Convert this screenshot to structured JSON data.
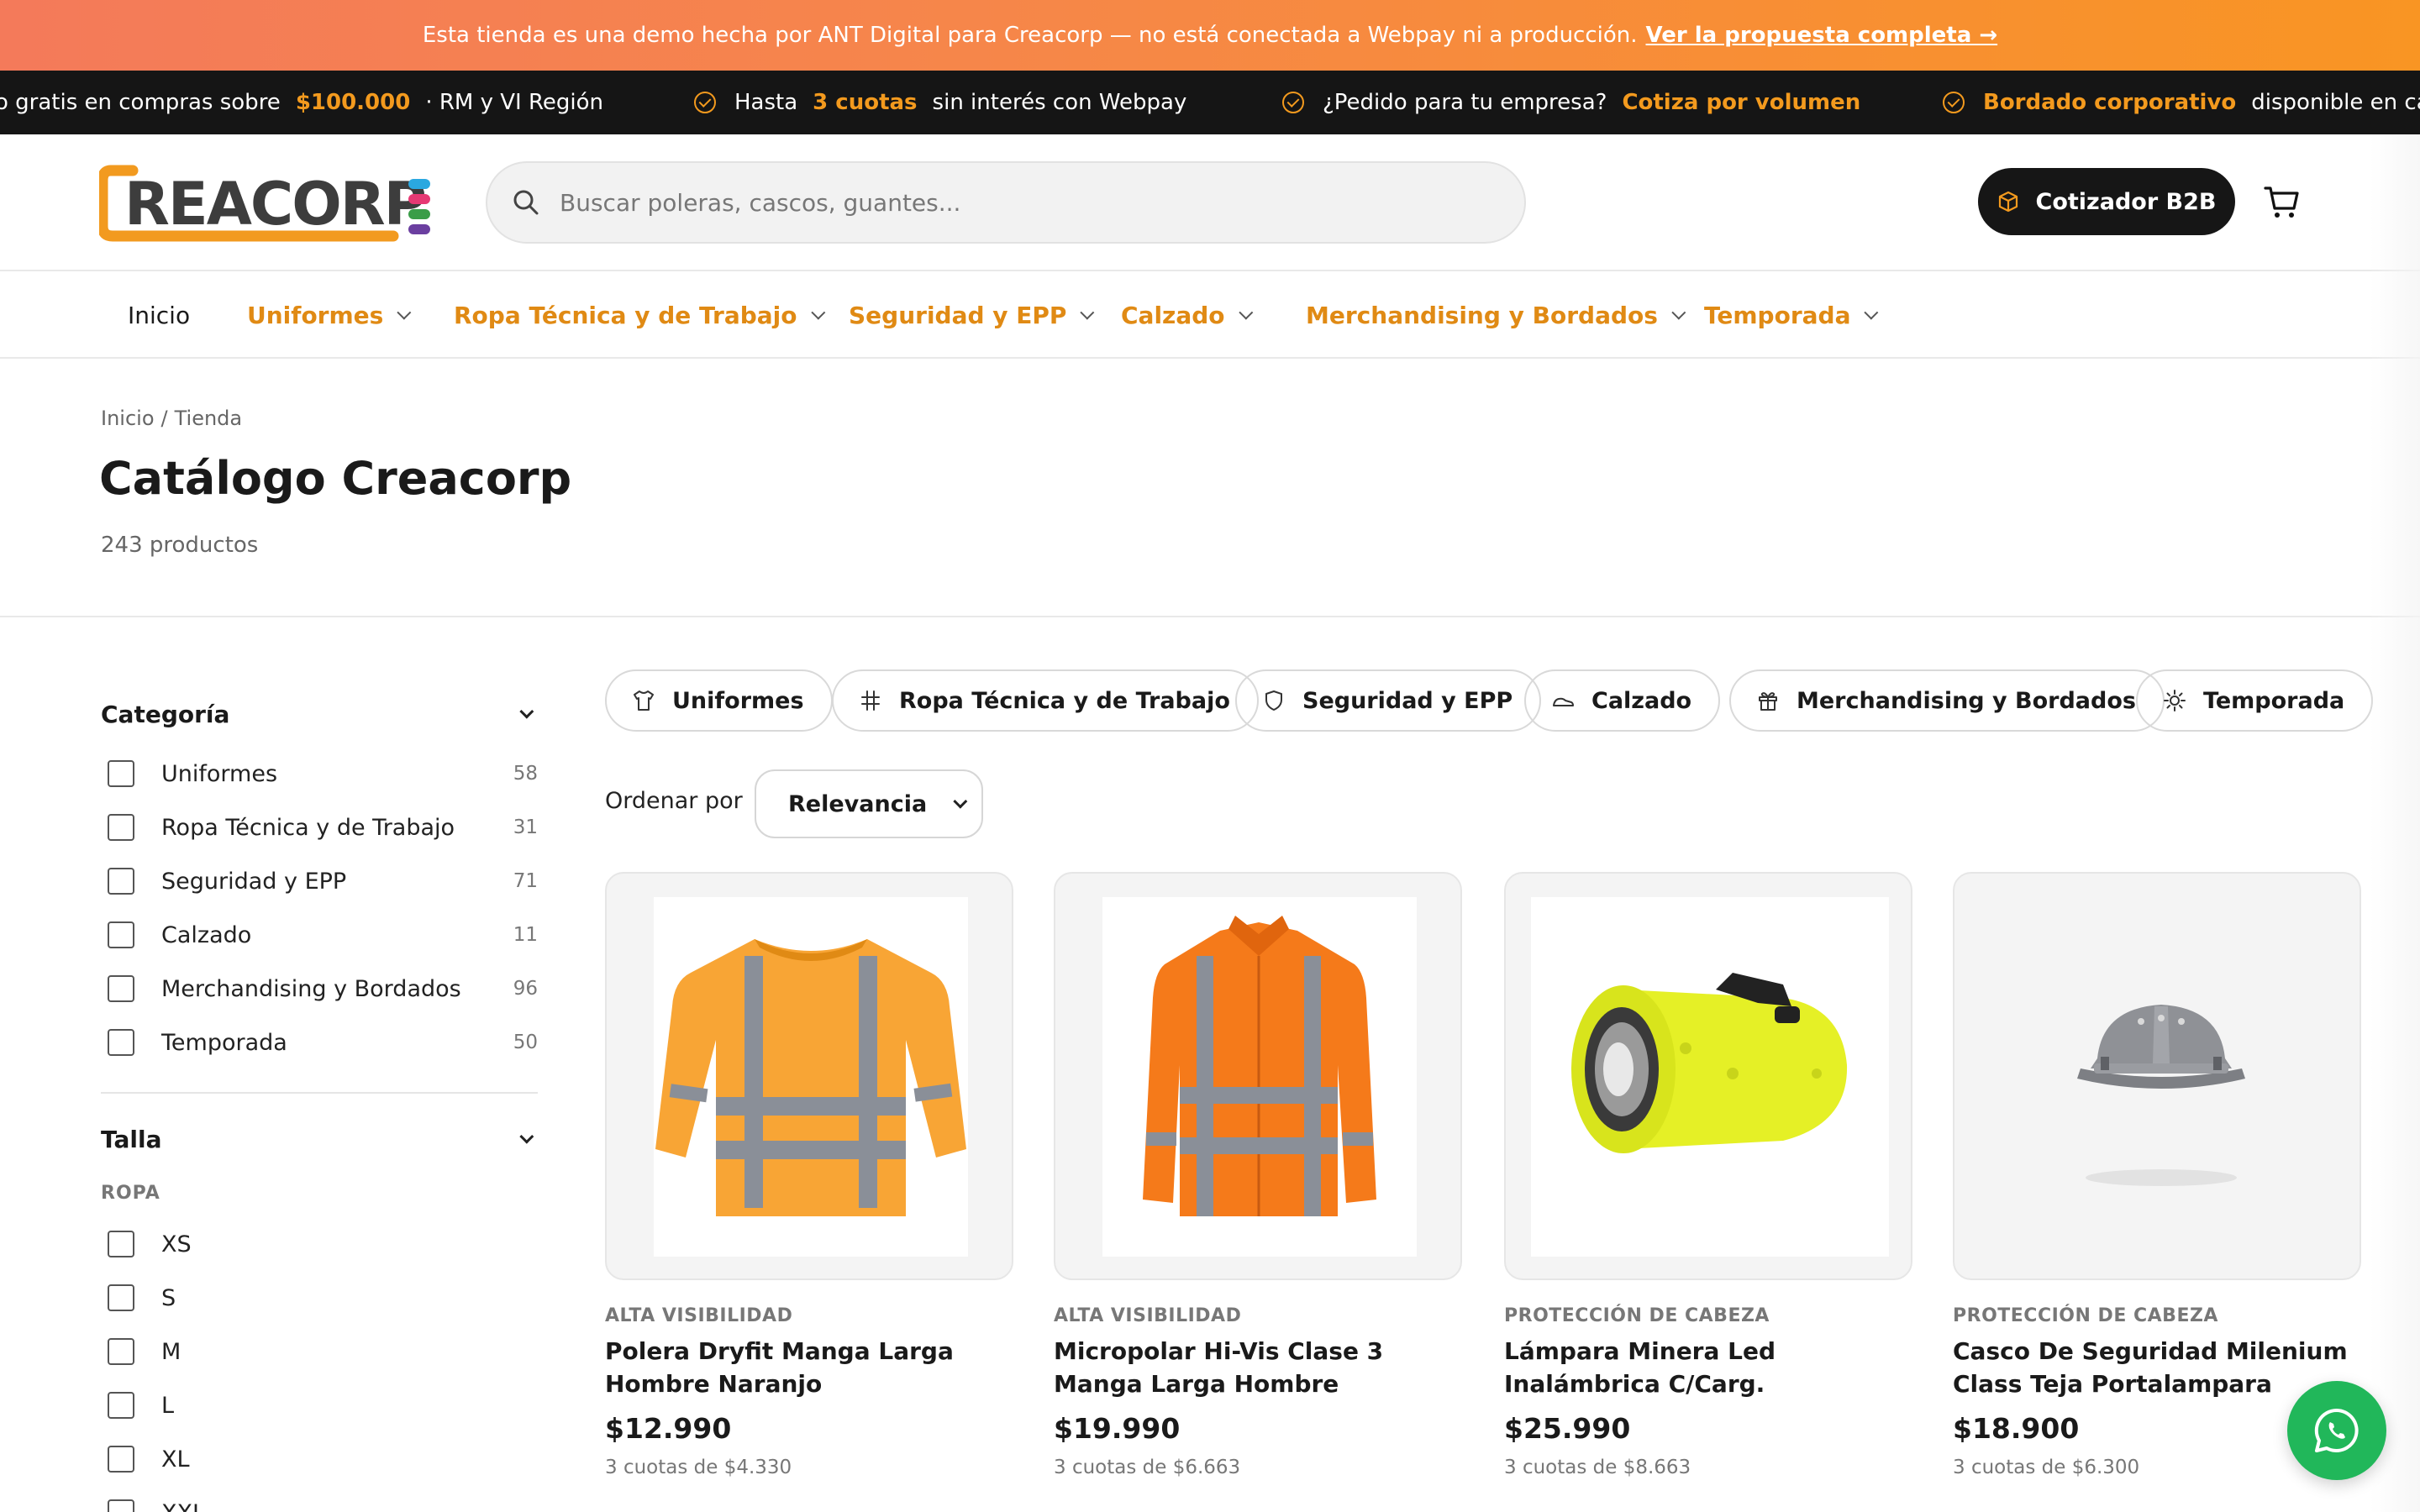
{
  "demo_banner": {
    "text": "Esta tienda es una demo hecha por ANT Digital para Creacorp — no está conectada a Webpay ni a producción.",
    "link": "Ver la propuesta completa →"
  },
  "ticker": [
    {
      "pre": "o gratis en compras sobre",
      "highlight": "$100.000",
      "post": "· RM y VI Región"
    },
    {
      "pre": "Hasta",
      "highlight": "3 cuotas",
      "post": "sin interés con Webpay"
    },
    {
      "pre": "¿Pedido para tu empresa?",
      "highlight": "Cotiza por volumen",
      "post": ""
    },
    {
      "pre": "",
      "highlight": "Bordado corporativo",
      "post": "disponible en ca"
    }
  ],
  "header": {
    "logo_text": "REACORP",
    "search_placeholder": "Buscar poleras, cascos, guantes...",
    "b2b_label": "Cotizador B2B",
    "cart_icon": "cart-icon"
  },
  "nav": {
    "items": [
      {
        "label": "Inicio"
      },
      {
        "label": "Uniformes"
      },
      {
        "label": "Ropa Técnica y de Trabajo"
      },
      {
        "label": "Seguridad y EPP"
      },
      {
        "label": "Calzado"
      },
      {
        "label": "Merchandising y Bordados"
      },
      {
        "label": "Temporada"
      }
    ]
  },
  "breadcrumb": {
    "home": "Inicio",
    "sep": "/",
    "current": "Tienda"
  },
  "page": {
    "title": "Catálogo Creacorp",
    "count": "243 productos"
  },
  "filters": {
    "category_title": "Categoría",
    "categories": [
      {
        "label": "Uniformes",
        "count": "58"
      },
      {
        "label": "Ropa Técnica y de Trabajo",
        "count": "31"
      },
      {
        "label": "Seguridad y EPP",
        "count": "71"
      },
      {
        "label": "Calzado",
        "count": "11"
      },
      {
        "label": "Merchandising y Bordados",
        "count": "96"
      },
      {
        "label": "Temporada",
        "count": "50"
      }
    ],
    "size_title": "Talla",
    "size_group": "ROPA",
    "sizes": [
      "XS",
      "S",
      "M",
      "L",
      "XL",
      "XXL"
    ]
  },
  "chips": [
    {
      "label": "Uniformes",
      "icon": "shirt-icon"
    },
    {
      "label": "Ropa Técnica y de Trabajo",
      "icon": "ruler-icon"
    },
    {
      "label": "Seguridad y EPP",
      "icon": "shield-icon"
    },
    {
      "label": "Calzado",
      "icon": "shoe-icon"
    },
    {
      "label": "Merchandising y Bordados",
      "icon": "gift-icon"
    },
    {
      "label": "Temporada",
      "icon": "sun-icon"
    }
  ],
  "sort": {
    "label": "Ordenar por",
    "value": "Relevancia"
  },
  "products": [
    {
      "category": "ALTA VISIBILIDAD",
      "name": "Polera Dryfit Manga Larga Hombre Naranjo",
      "price": "$12.990",
      "installments": "3 cuotas de $4.330",
      "image": "orange-hivis-longsleeve-shirt"
    },
    {
      "category": "ALTA VISIBILIDAD",
      "name": "Micropolar Hi-Vis Clase 3 Manga Larga Hombre",
      "price": "$19.990",
      "installments": "3 cuotas de $6.663",
      "image": "orange-hivis-fleece-jacket"
    },
    {
      "category": "PROTECCIÓN DE CABEZA",
      "name": "Lámpara Minera Led Inalámbrica C/Carg.",
      "price": "$25.990",
      "installments": "3 cuotas de $8.663",
      "image": "yellow-mining-lamp"
    },
    {
      "category": "PROTECCIÓN DE CABEZA",
      "name": "Casco De Seguridad Milenium Class Teja Portalampara",
      "price": "$18.900",
      "installments": "3 cuotas de $6.300",
      "image": "grey-safety-helmet"
    }
  ],
  "colors": {
    "accent": "#e08a14",
    "dark": "#161616",
    "whatsapp": "#21b75a"
  }
}
